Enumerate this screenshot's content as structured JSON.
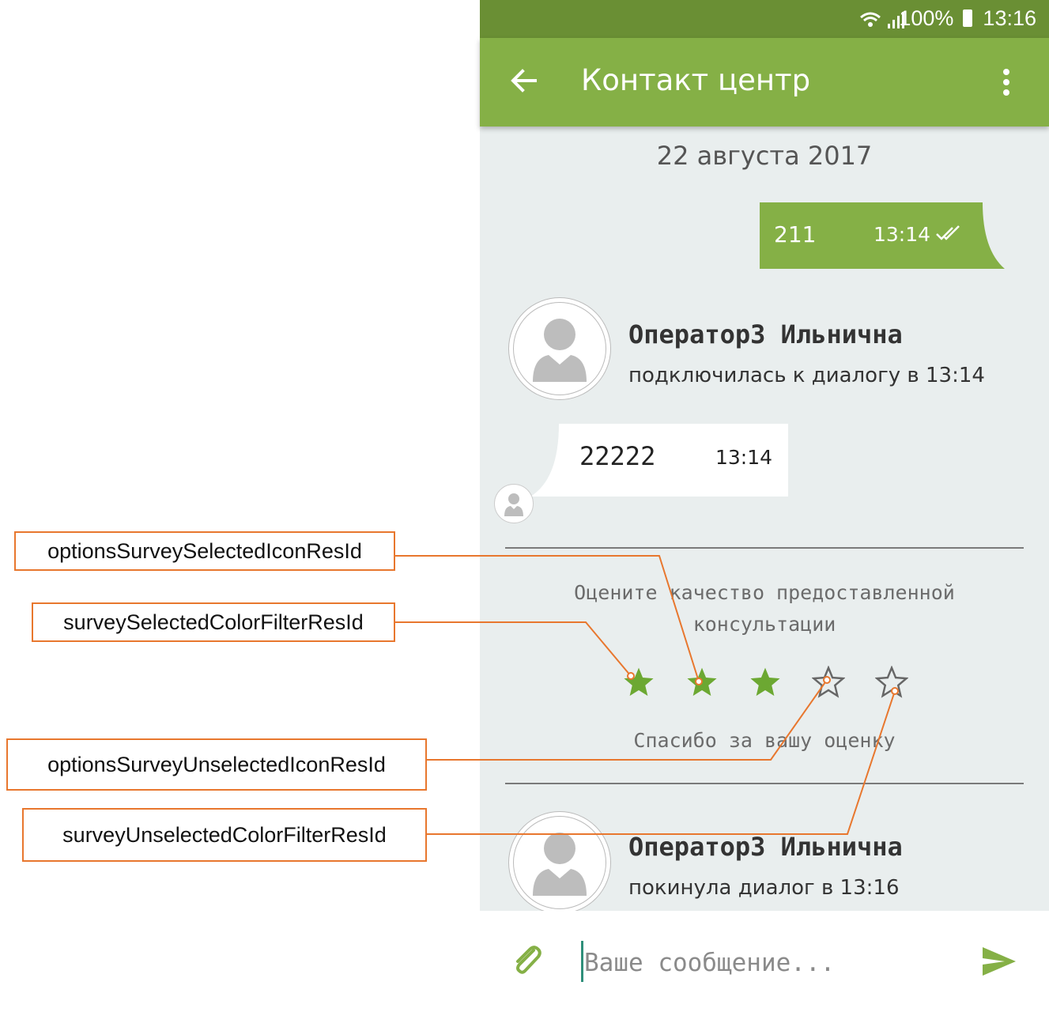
{
  "status_bar": {
    "battery": "100%",
    "time": "13:16",
    "icons": [
      "wifi-icon",
      "signal-icon",
      "battery-icon"
    ]
  },
  "app_bar": {
    "title": "Контакт центр",
    "back_icon": "arrow-back-icon",
    "menu_icon": "more-vert-icon"
  },
  "chat": {
    "date": "22 августа 2017",
    "outgoing": {
      "text": "211",
      "time": "13:14",
      "status_icon": "double-check-icon"
    },
    "operator_join": {
      "name": "Оператор3 Ильнична",
      "status": "подключилась к диалогу в 13:14"
    },
    "incoming": {
      "text": "22222",
      "time": "13:14"
    },
    "survey": {
      "question": "Оцените качество предоставленной консультации",
      "rating": 3,
      "max_rating": 5,
      "thanks": "Спасибо за вашу оценку"
    },
    "operator_leave": {
      "name": "Оператор3 Ильнична",
      "status": "покинула диалог в 13:16"
    }
  },
  "composer": {
    "placeholder": "Ваше сообщение...",
    "attach_icon": "paperclip-icon",
    "send_icon": "send-icon"
  },
  "annotations": {
    "selected_icon": "optionsSurveySelectedIconResId",
    "selected_color": "surveySelectedColorFilterResId",
    "unselected_icon": "optionsSurveyUnselectedIconResId",
    "unselected_color": "surveyUnselectedColorFilterResId"
  },
  "colors": {
    "accent": "#85b046",
    "status_bar": "#6a8f34",
    "annotation": "#e8772e"
  }
}
